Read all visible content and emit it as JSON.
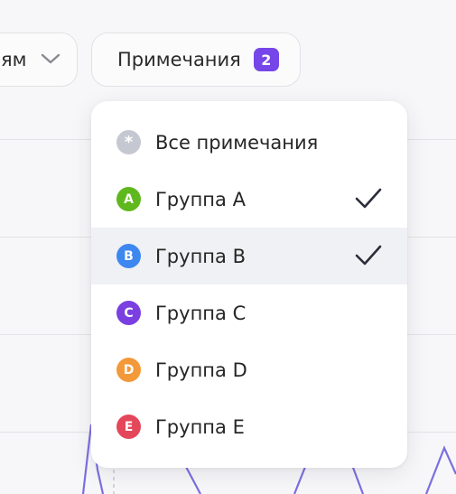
{
  "filter_left": {
    "label": "ям"
  },
  "notes_filter": {
    "label": "Примечания",
    "count": "2"
  },
  "menu": {
    "items": [
      {
        "label": "Все примечания",
        "marker": "*",
        "color": "#c5c8d1",
        "checked": false
      },
      {
        "label": "Группа A",
        "marker": "A",
        "color": "#5fb81e",
        "checked": true
      },
      {
        "label": "Группа B",
        "marker": "B",
        "color": "#3d87f0",
        "checked": true
      },
      {
        "label": "Группа C",
        "marker": "C",
        "color": "#7a3fe0",
        "checked": false
      },
      {
        "label": "Группа D",
        "marker": "D",
        "color": "#f3993a",
        "checked": false
      },
      {
        "label": "Группа E",
        "marker": "E",
        "color": "#e4475a",
        "checked": false
      }
    ]
  },
  "icons": {
    "chevron": "chevron-down-icon",
    "check": "checkmark-icon"
  },
  "colors": {
    "accent": "#7646e8",
    "series_line": "#7b6fe0"
  }
}
